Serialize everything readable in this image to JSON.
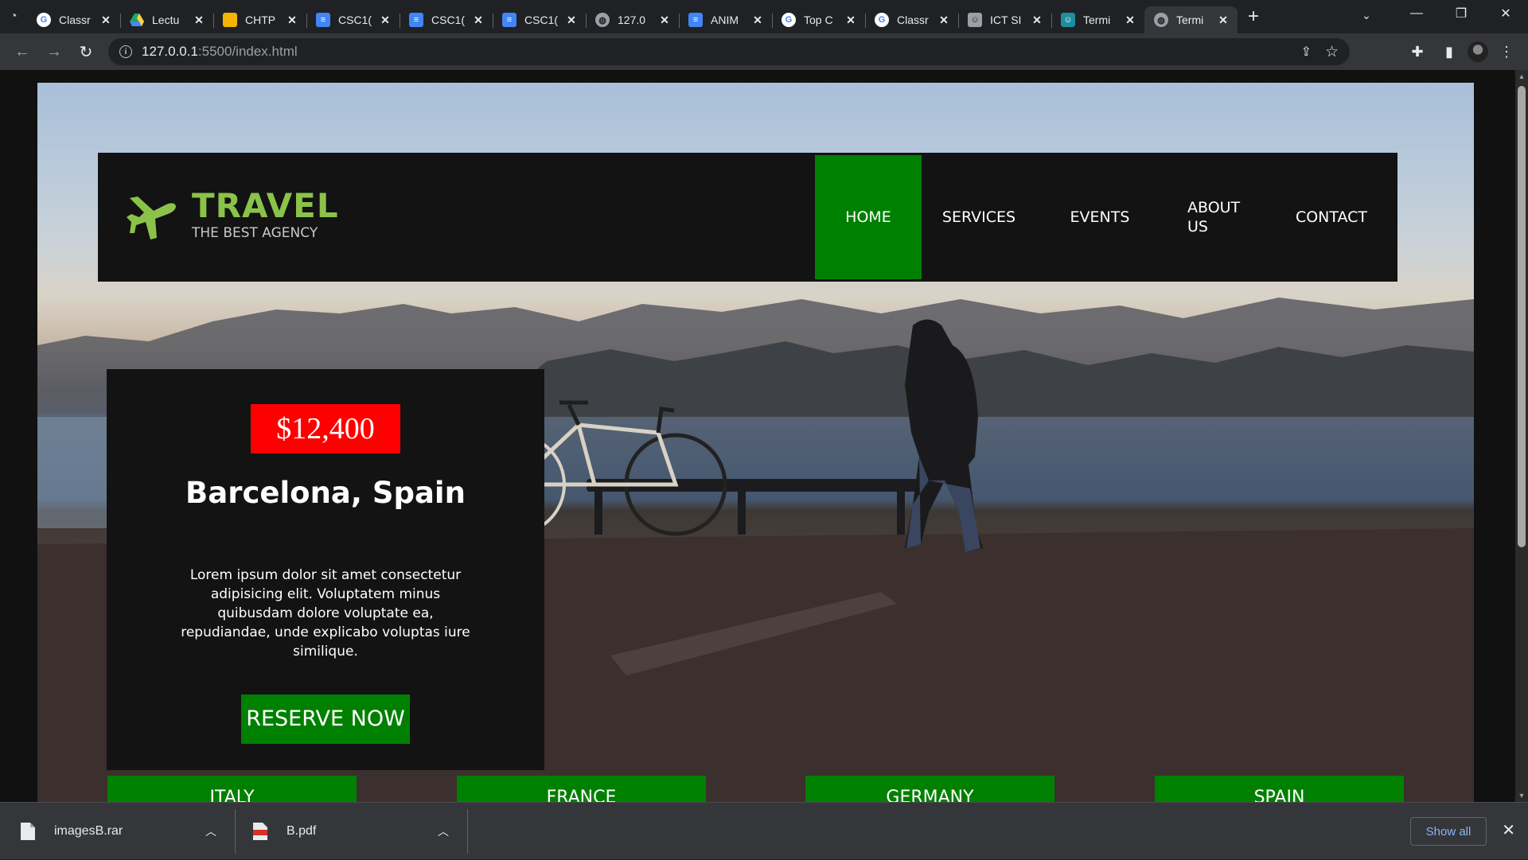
{
  "browser": {
    "tabs": [
      {
        "title": "Classr",
        "favicon": "google-icon",
        "active": false
      },
      {
        "title": "Lectu",
        "favicon": "drive-icon",
        "active": false
      },
      {
        "title": "CHTP",
        "favicon": "slides-icon",
        "active": false
      },
      {
        "title": "CSC1(",
        "favicon": "docs-icon",
        "active": false
      },
      {
        "title": "CSC1(",
        "favicon": "docs-icon",
        "active": false
      },
      {
        "title": "CSC1(",
        "favicon": "docs-icon",
        "active": false
      },
      {
        "title": "127.0",
        "favicon": "globe-icon",
        "active": false
      },
      {
        "title": "ANIM",
        "favicon": "docs-icon",
        "active": false
      },
      {
        "title": "Top C",
        "favicon": "google-icon",
        "active": false
      },
      {
        "title": "Classr",
        "favicon": "google-icon",
        "active": false
      },
      {
        "title": "ICT SI",
        "favicon": "contact-icon",
        "active": false
      },
      {
        "title": "Termi",
        "favicon": "classroom-icon",
        "active": false
      },
      {
        "title": "Termi",
        "favicon": "globe-icon",
        "active": true
      }
    ],
    "url_host": "127.0.0.1",
    "url_path": ":5500/index.html"
  },
  "site": {
    "logo_title": "TRAVEL",
    "logo_subtitle": "THE BEST AGENCY",
    "nav": {
      "home": "HOME",
      "services": "SERVICES",
      "events": "EVENTS",
      "about_line1": "ABOUT",
      "about_line2": "US",
      "contact": "CONTACT"
    },
    "card": {
      "price": "$12,400",
      "destination": "Barcelona, Spain",
      "description": "Lorem ipsum dolor sit amet consectetur adipisicing elit. Voluptatem minus quibusdam dolore voluptate ea, repudiandae, unde explicabo voluptas iure similique.",
      "cta": "RESERVE NOW"
    },
    "countries": [
      "ITALY",
      "FRANCE",
      "GERMANY",
      "SPAIN"
    ],
    "colors": {
      "accent_green": "#008000",
      "logo_green": "#8bc34a",
      "price_red": "#ff0000",
      "panel": "#131313"
    }
  },
  "downloads": {
    "items": [
      "imagesB.rar",
      "B.pdf"
    ],
    "show_all": "Show all"
  }
}
